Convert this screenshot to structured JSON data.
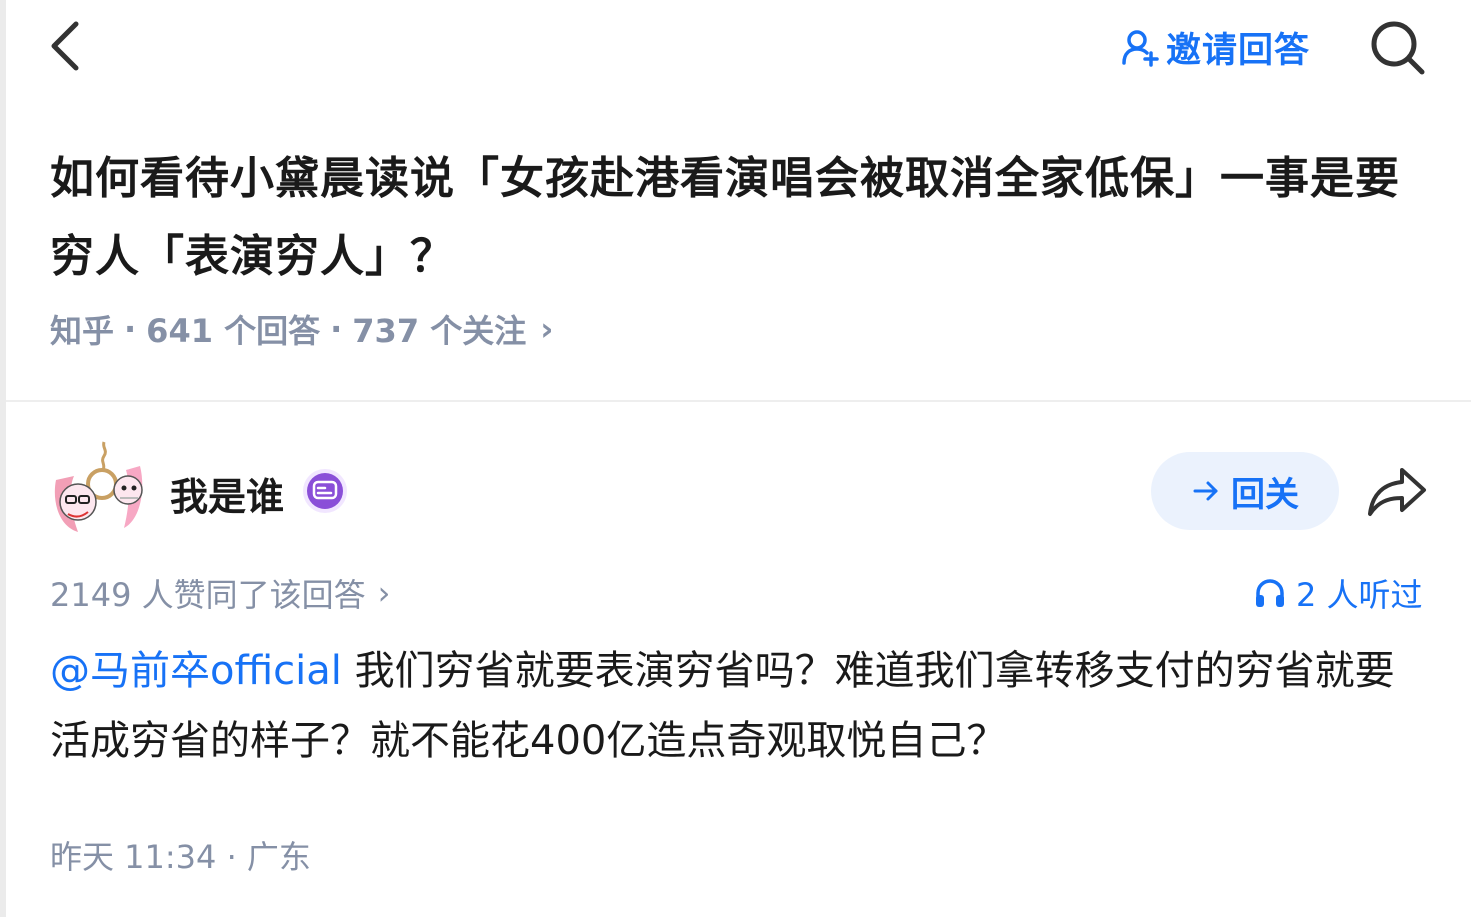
{
  "top_bar": {
    "invite_label": "邀请回答",
    "accent_color": "#1772f6",
    "icons": [
      "back-arrow-icon",
      "invite-user-icon",
      "search-icon"
    ]
  },
  "question": {
    "title": "如何看待小黛晨读说「女孩赴港看演唱会被取消全家低保」一事是要穷人「表演穷人」？",
    "source": "知乎",
    "separator": "·",
    "answers_count": "641 个回答",
    "followers_count": "737 个关注",
    "chevron": "›"
  },
  "answer": {
    "author": {
      "name": "我是谁",
      "avatar_icon": "avatar-image",
      "badge_icon": "message-badge-icon"
    },
    "follow_label": "回关",
    "share_icon": "share-arrow-icon",
    "upvotes": "2149 人赞同了该回答",
    "upvotes_chevron": "›",
    "listen": {
      "icon": "headphones-icon",
      "label": "2 人听过"
    },
    "mention": "@马前卒official",
    "body": " 我们穷省就要表演穷省吗？难道我们拿转移支付的穷省就要活成穷省的样子？就不能花400亿造点奇观取悦自己？",
    "time": "昨天 11:34",
    "location": "广东",
    "time_separator": "·"
  }
}
